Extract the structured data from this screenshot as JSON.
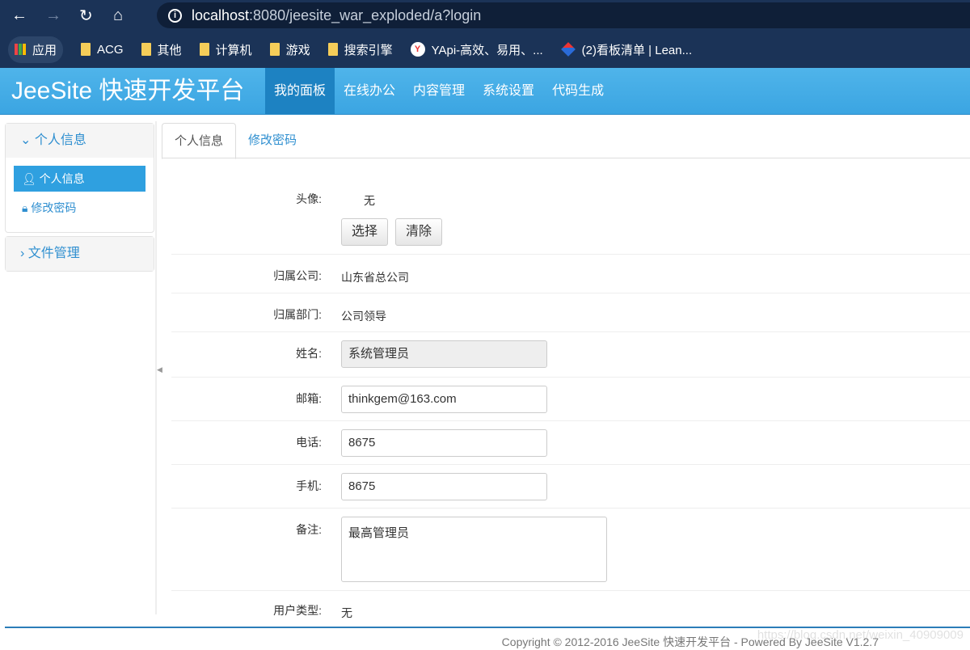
{
  "browser": {
    "url_host": "localhost",
    "url_rest": ":8080/jeesite_war_exploded/a?login",
    "bookmarks": [
      "应用",
      "ACG",
      "其他",
      "计算机",
      "游戏",
      "搜索引擎",
      "YApi-高效、易用、...",
      "(2)看板清单 | Lean..."
    ]
  },
  "header": {
    "brand": "JeeSite 快速开发平台",
    "nav": [
      "我的面板",
      "在线办公",
      "内容管理",
      "系统设置",
      "代码生成"
    ]
  },
  "sidebar": {
    "group1": "个人信息",
    "items": [
      "个人信息",
      "修改密码"
    ],
    "group2": "文件管理"
  },
  "tabs": [
    "个人信息",
    "修改密码"
  ],
  "form": {
    "avatar_label": "头像:",
    "avatar_value": "无",
    "select_btn": "选择",
    "clear_btn": "清除",
    "company_label": "归属公司:",
    "company": "山东省总公司",
    "dept_label": "归属部门:",
    "dept": "公司领导",
    "name_label": "姓名:",
    "name": "系统管理员",
    "email_label": "邮箱:",
    "email": "thinkgem@163.com",
    "phone_label": "电话:",
    "phone": "8675",
    "mobile_label": "手机:",
    "mobile": "8675",
    "remarks_label": "备注:",
    "remarks": "最高管理员",
    "type_label": "用户类型:",
    "type": "无"
  },
  "footer": {
    "copyright": "Copyright © 2012-2016 JeeSite 快速开发平台 - Powered By JeeSite V1.2.7",
    "watermark": "https://blog.csdn.net/weixin_40909009"
  }
}
